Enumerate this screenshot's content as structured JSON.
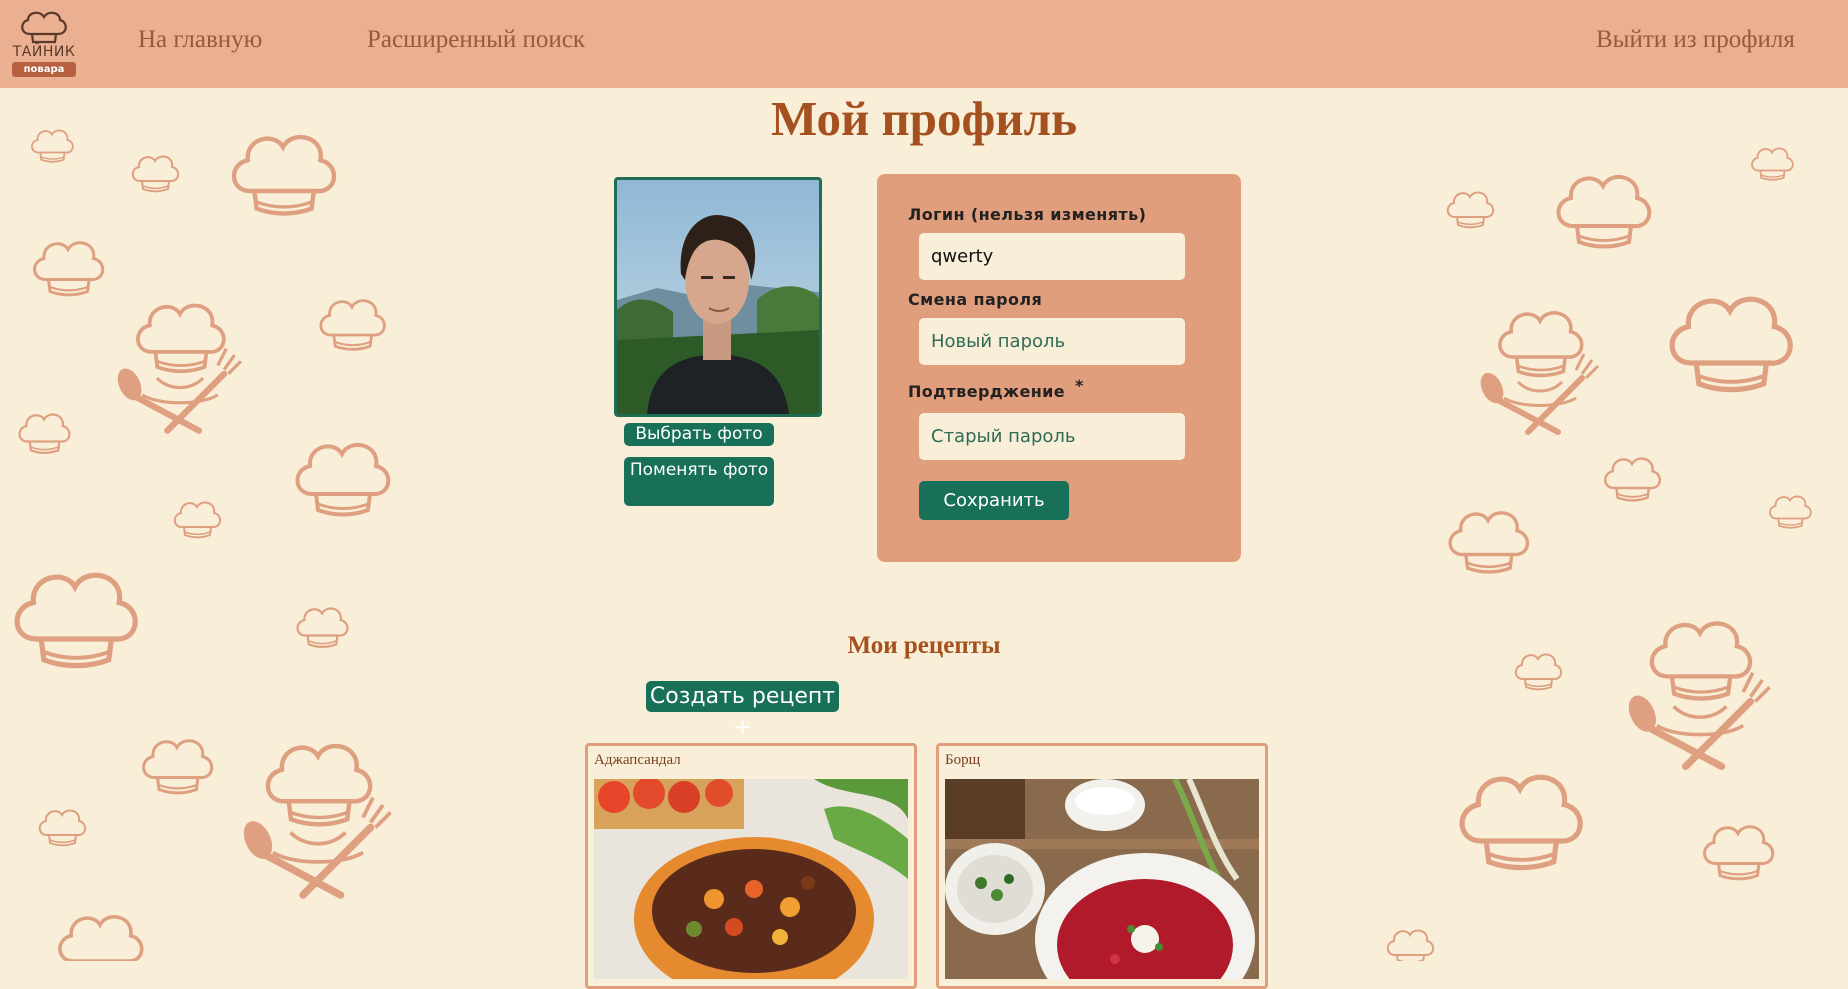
{
  "header": {
    "logo": {
      "title": "ТАЙНИК",
      "ribbon": "повара"
    },
    "nav": {
      "home": "На главную",
      "advanced_search": "Расширенный поиск",
      "logout": "Выйти из профиля"
    }
  },
  "page": {
    "title": "Мой профиль"
  },
  "photo": {
    "choose_label": "Выбрать фото",
    "change_label": "Поменять фото"
  },
  "form": {
    "login_label": "Логин (нельзя изменять)",
    "login_value": "qwerty",
    "password_label": "Смена пароля",
    "new_password_placeholder": "Новый пароль",
    "confirm_label": "Подтверджение",
    "confirm_required_mark": "*",
    "old_password_placeholder": "Старый пароль",
    "save_label": "Сохранить"
  },
  "recipes": {
    "title": "Мои рецепты",
    "create_label": "Создать рецепт +",
    "items": [
      {
        "title": "Аджапсандал"
      },
      {
        "title": "Борщ"
      }
    ]
  },
  "colors": {
    "background": "#f9efd8",
    "header": "#ebb091",
    "accent_green": "#187059",
    "title_brown": "#a4501f",
    "form_card": "#e09e7c"
  }
}
